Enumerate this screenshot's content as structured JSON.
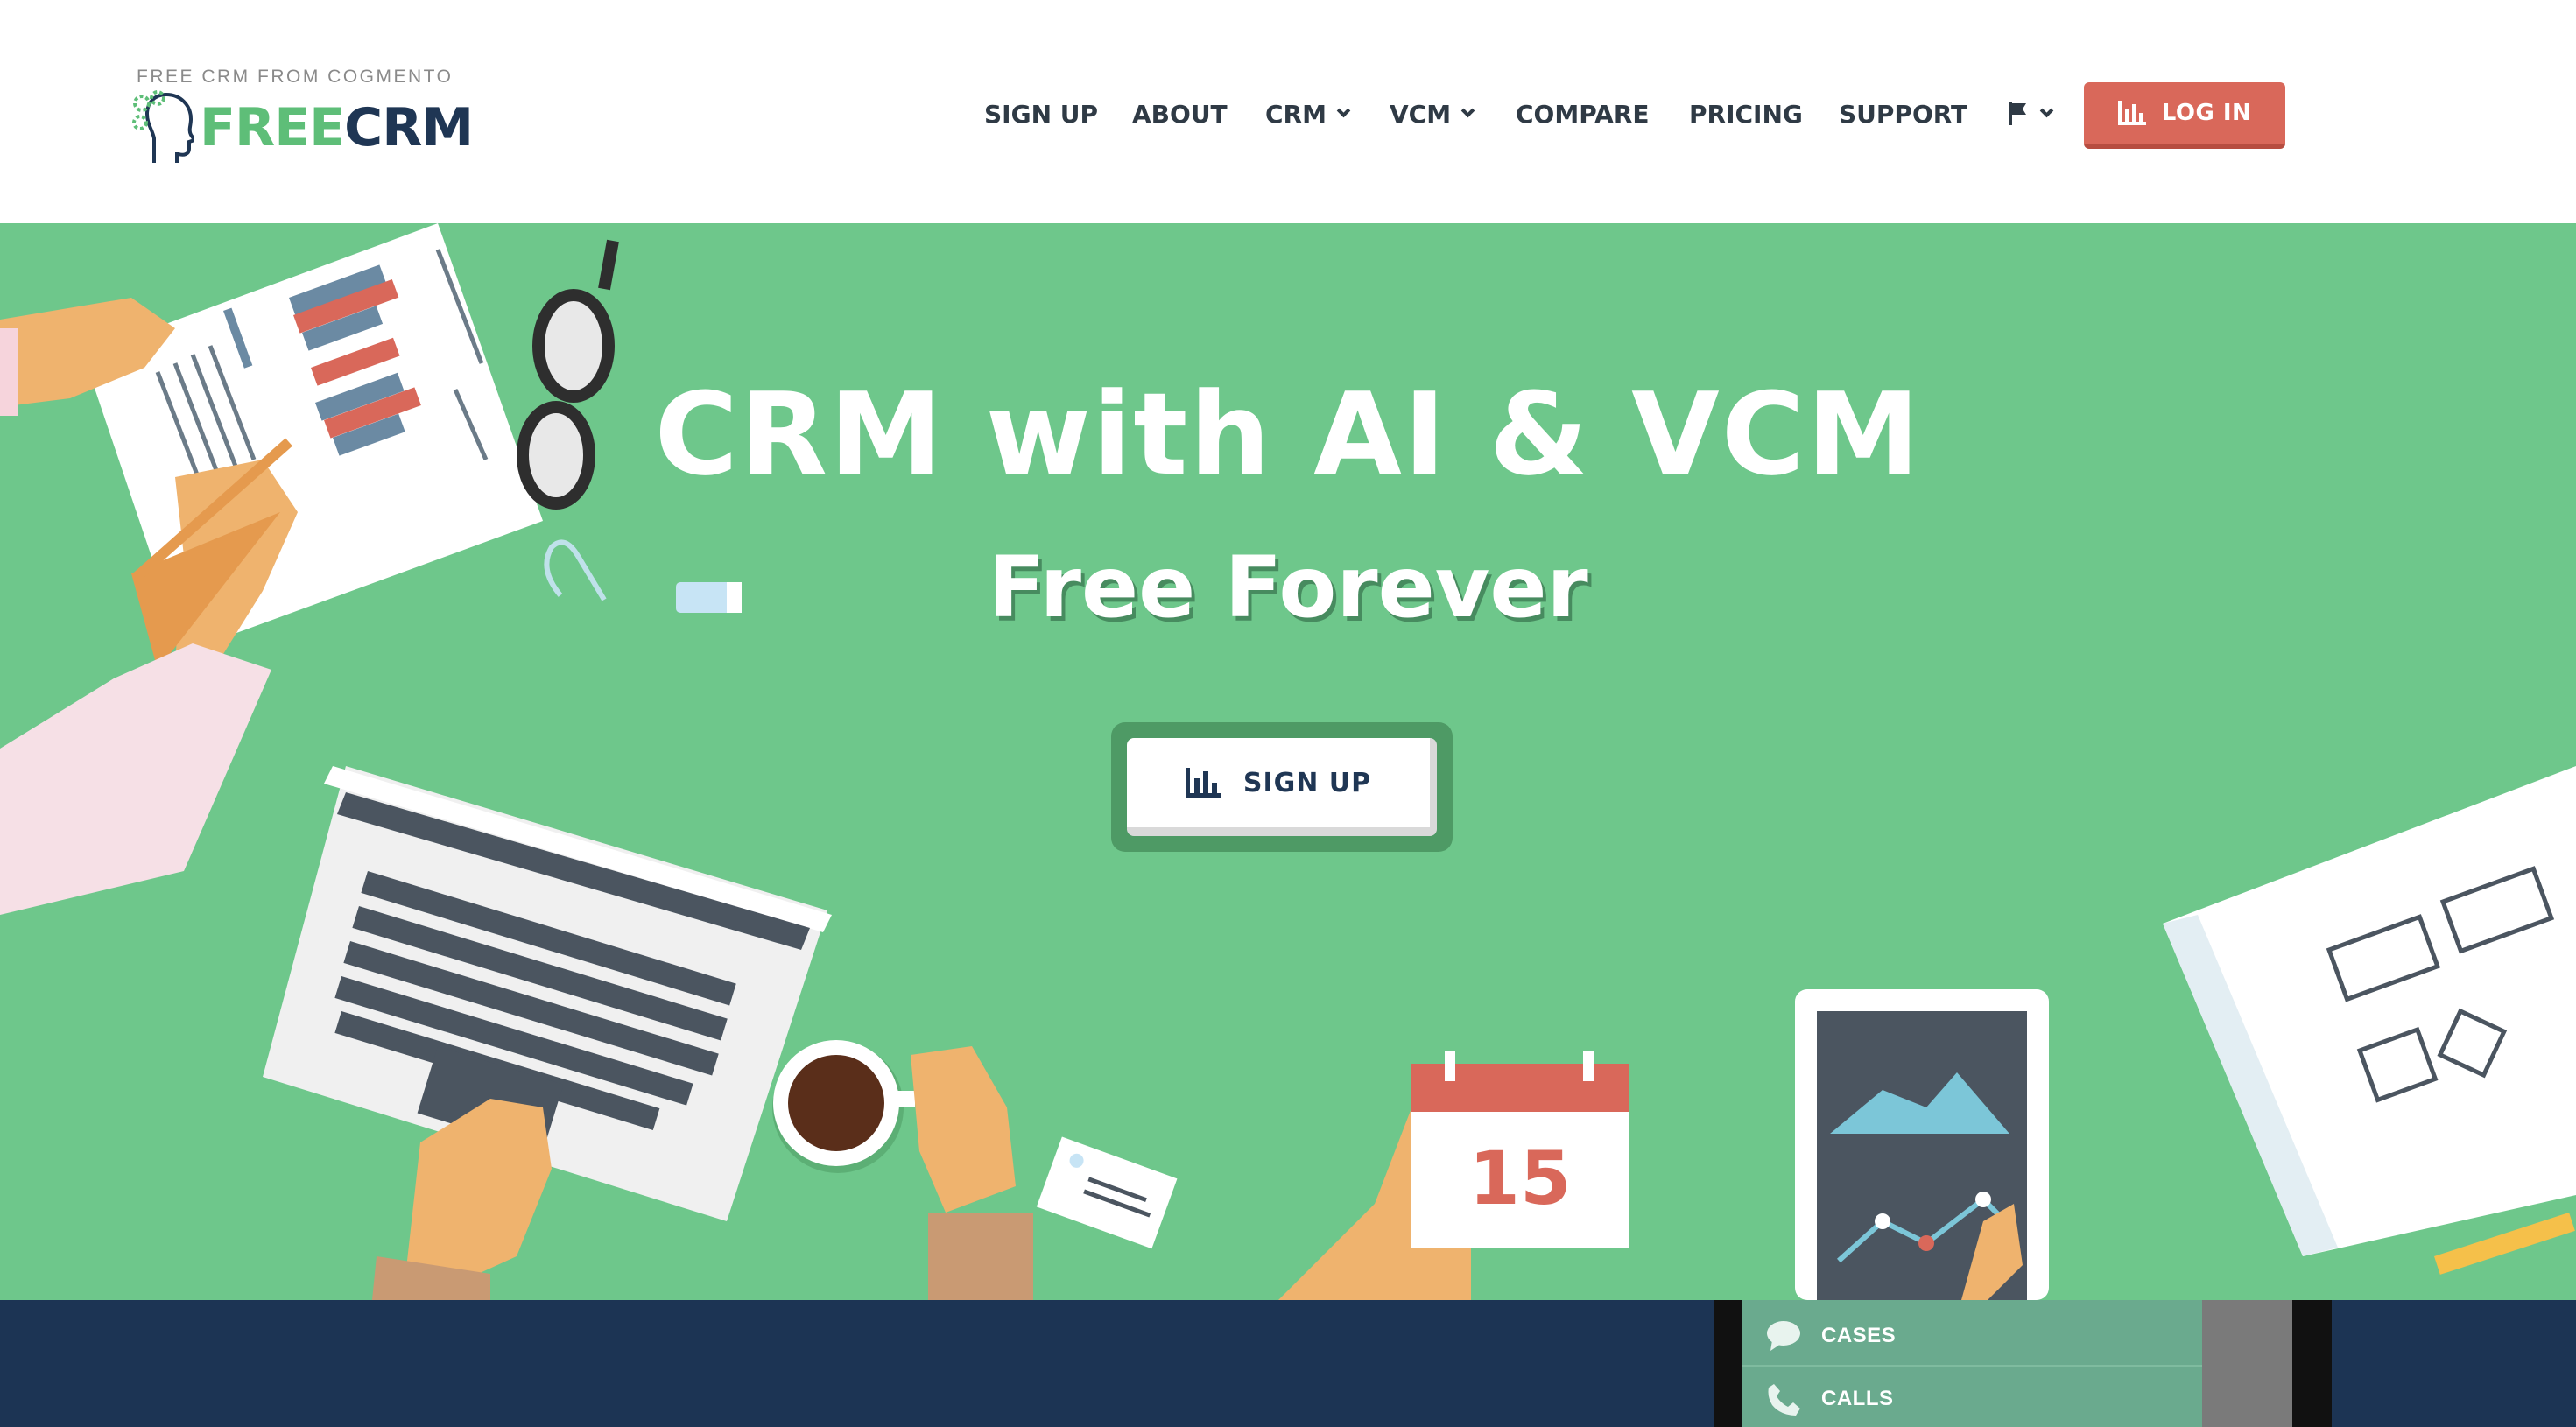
{
  "logo": {
    "tagline": "FREE CRM FROM COGMENTO",
    "word_part1": "FREE",
    "word_part2": "CRM",
    "icon": "head-gears-icon"
  },
  "nav": {
    "items": [
      {
        "label": "SIGN UP",
        "dropdown": false
      },
      {
        "label": "ABOUT",
        "dropdown": false
      },
      {
        "label": "CRM",
        "dropdown": true
      },
      {
        "label": "VCM",
        "dropdown": true
      },
      {
        "label": "COMPARE",
        "dropdown": false
      },
      {
        "label": "PRICING",
        "dropdown": false
      },
      {
        "label": "SUPPORT",
        "dropdown": false
      }
    ],
    "language_icon": "flag-icon",
    "login": {
      "label": "LOG IN",
      "icon": "bar-chart-icon"
    }
  },
  "hero": {
    "title": "CRM with AI & VCM",
    "subtitle": "Free Forever",
    "cta": {
      "label": "SIGN UP",
      "icon": "bar-chart-icon"
    },
    "calendar_day": "15"
  },
  "band": {
    "phone_menu": [
      {
        "label": "CASES",
        "icon": "chat-bubble-icon"
      },
      {
        "label": "CALLS",
        "icon": "phone-icon"
      }
    ]
  },
  "colors": {
    "hero_bg": "#6ec78b",
    "brand_green": "#5ebe78",
    "brand_navy": "#1f3654",
    "login_bg": "#d9685a",
    "band_bg": "#1c3454"
  }
}
